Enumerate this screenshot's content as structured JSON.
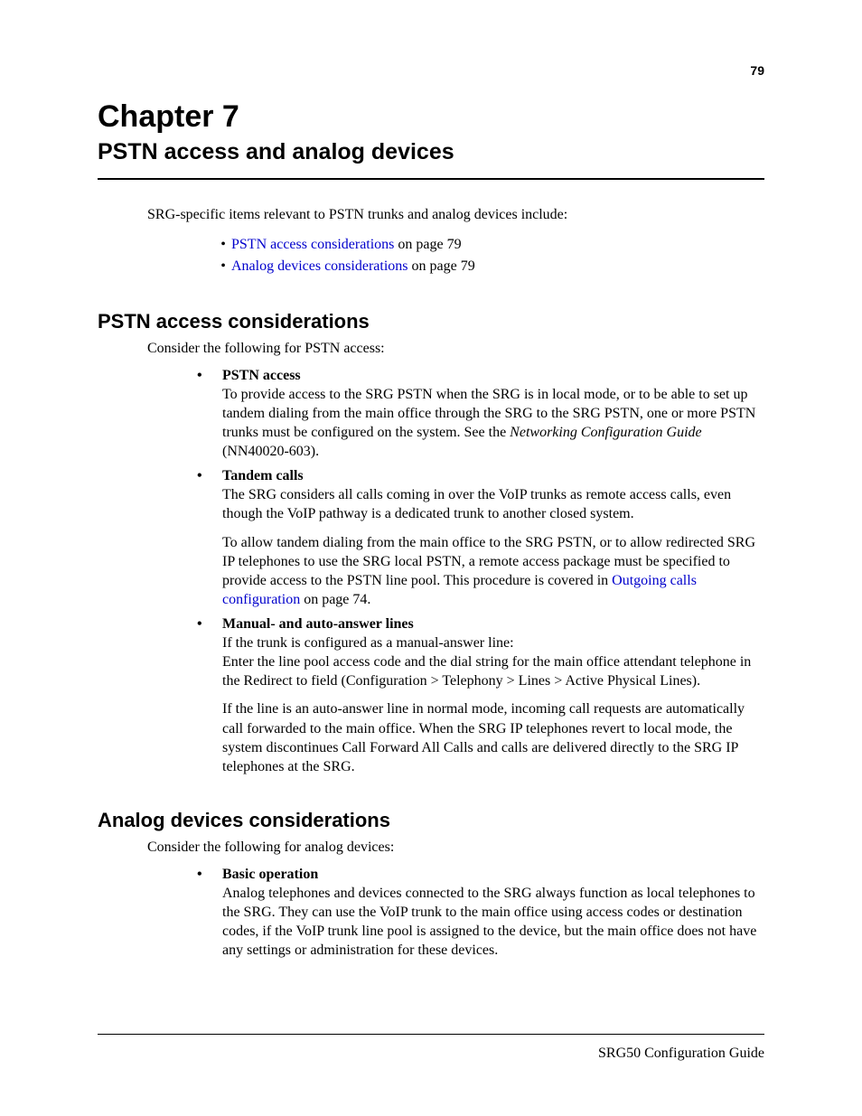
{
  "page_number": "79",
  "chapter": {
    "title": "Chapter 7",
    "subtitle": "PSTN access and analog devices"
  },
  "intro": "SRG-specific items relevant to PSTN trunks and analog devices include:",
  "toc": [
    {
      "link": "PSTN access considerations",
      "suffix": " on page 79"
    },
    {
      "link": "Analog devices considerations",
      "suffix": " on page 79"
    }
  ],
  "section1": {
    "title": "PSTN access considerations",
    "intro": "Consider the following for PSTN access:",
    "items": {
      "pstn_access": {
        "heading": "PSTN access",
        "p1a": "To provide access to the SRG PSTN when the SRG is in local mode, or to be able to set up tandem dialing from the main office through the SRG to the SRG PSTN, one or more PSTN trunks must be configured on the system. See the ",
        "doc_title": "Networking Configuration Guide",
        "p1b": " (NN40020-603)."
      },
      "tandem": {
        "heading": "Tandem calls",
        "p1": "The SRG considers all calls coming in over the VoIP trunks as remote access calls, even though the VoIP pathway is a dedicated trunk to another closed system.",
        "p2a": "To allow tandem dialing from the main office to the SRG PSTN, or to allow redirected SRG IP telephones to use the SRG local PSTN, a remote access package must be specified to provide access to the PSTN line pool. This procedure is covered in ",
        "p2_link": "Outgoing calls configuration",
        "p2b": " on page 74."
      },
      "manual": {
        "heading": "Manual- and auto-answer lines",
        "p1": "If the trunk is configured as a manual-answer line:",
        "p2": "Enter the line pool access code and the dial string for the main office attendant telephone in the Redirect to field (Configuration > Telephony > Lines > Active Physical Lines).",
        "p3": "If the line is an auto-answer line in normal mode, incoming call requests are automatically call forwarded to the main office. When the SRG IP telephones revert to local mode, the system discontinues Call Forward All Calls and calls are delivered directly to the SRG IP telephones at the SRG."
      }
    }
  },
  "section2": {
    "title": "Analog devices considerations",
    "intro": "Consider the following for analog devices:",
    "items": {
      "basic": {
        "heading": "Basic operation",
        "p1": "Analog telephones and devices connected to the SRG always function as local telephones to the SRG. They can use the VoIP trunk to the main office using access codes or destination codes, if the VoIP trunk line pool is assigned to the device, but the main office does not have any settings or administration for these devices."
      }
    }
  },
  "footer": "SRG50 Configuration Guide"
}
